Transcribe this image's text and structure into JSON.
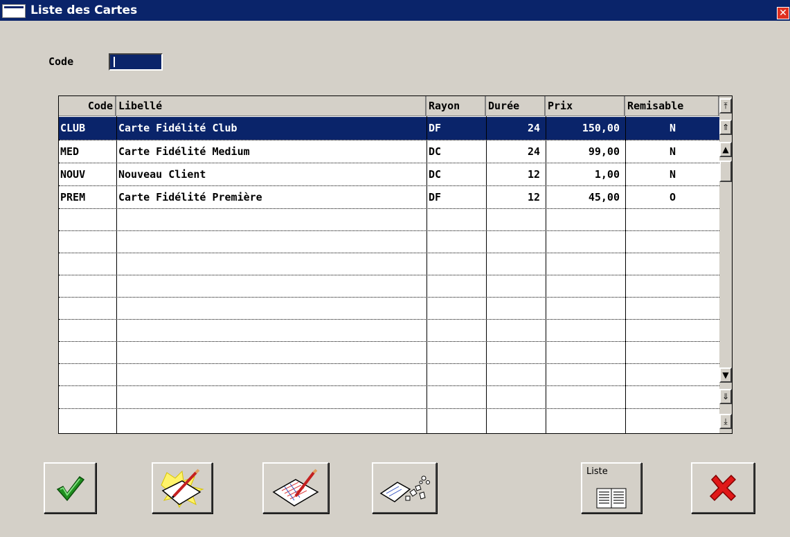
{
  "window": {
    "title": "Liste des Cartes",
    "close_glyph": "✕"
  },
  "filter": {
    "code_label": "Code",
    "code_value": ""
  },
  "table": {
    "headers": [
      "Code",
      "Libellé",
      "Rayon",
      "Durée",
      "Prix",
      "Remisable"
    ],
    "rows": [
      {
        "code": "CLUB",
        "libelle": "Carte Fidélité Club",
        "rayon": "DF",
        "duree": "24",
        "prix": "150,00",
        "remisable": "N"
      },
      {
        "code": "MED",
        "libelle": "Carte Fidélité Medium",
        "rayon": "DC",
        "duree": "24",
        "prix": "99,00",
        "remisable": "N"
      },
      {
        "code": "NOUV",
        "libelle": "Nouveau Client",
        "rayon": "DC",
        "duree": "12",
        "prix": "1,00",
        "remisable": "N"
      },
      {
        "code": "PREM",
        "libelle": "Carte Fidélité Première",
        "rayon": "DF",
        "duree": "12",
        "prix": "45,00",
        "remisable": "O"
      }
    ],
    "selected_row": 0
  },
  "toolbar": {
    "validate_icon": "checkmark-icon",
    "new_icon": "new-document-icon",
    "edit_icon": "edit-document-icon",
    "delete_icon": "shredded-document-icon",
    "list_label": "Liste",
    "list_icon": "list-icon",
    "cancel_icon": "red-x-icon"
  },
  "colors": {
    "accent": "#0a246a",
    "window_bg": "#d4d0c8",
    "selection": "#0a246a"
  }
}
